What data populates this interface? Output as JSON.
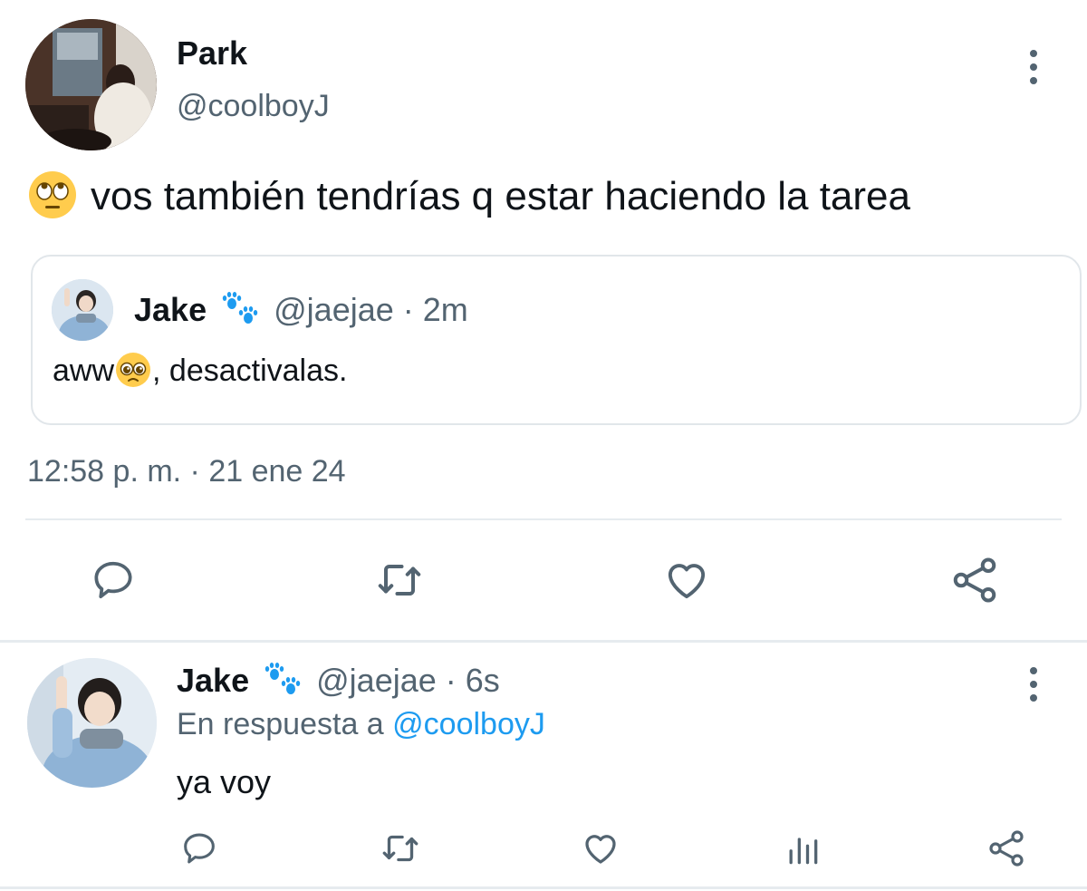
{
  "main_tweet": {
    "author_name": "Park",
    "author_handle": "@coolboyJ",
    "text": "vos también tendrías q estar haciendo la tarea",
    "emoji_icon": "rolling-eyes-emoji",
    "timestamp": "12:58 p. m. · 21 ene 24",
    "quoted": {
      "author_name": "Jake",
      "badge_icon": "paw-prints-icon",
      "handle_time": "@jaejae · 2m",
      "text_before": "aww",
      "emoji_icon": "pleading-face-emoji",
      "text_after": ", desactivalas."
    },
    "actions": [
      "reply-icon",
      "retweet-icon",
      "like-icon",
      "share-icon"
    ]
  },
  "reply_tweet": {
    "author_name": "Jake",
    "badge_icon": "paw-prints-icon",
    "handle_time": "@jaejae · 6s",
    "reply_prefix": "En respuesta a",
    "reply_to": "@coolboyJ",
    "text": "ya voy",
    "actions": [
      "reply-icon",
      "retweet-icon",
      "like-icon",
      "views-icon",
      "share-icon"
    ]
  },
  "colors": {
    "text": "#0f1419",
    "muted": "#536471",
    "link": "#1d9bf0",
    "border": "#e1e6ea",
    "paw": "#1d9bf0"
  }
}
